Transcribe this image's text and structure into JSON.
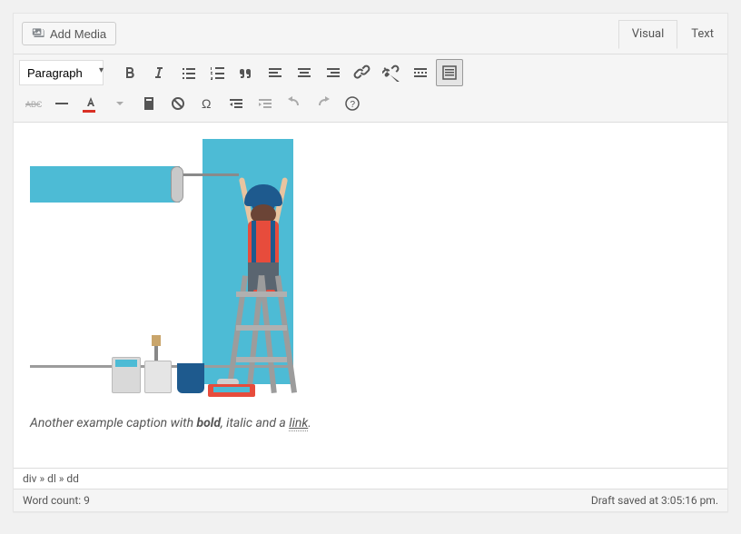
{
  "top": {
    "add_media": "Add Media",
    "tab_visual": "Visual",
    "tab_text": "Text"
  },
  "toolbar": {
    "format": "Paragraph"
  },
  "caption": {
    "t1": "Another example caption with ",
    "bold": "bold",
    "t2": ", italic and a ",
    "link": "link",
    "t3": "."
  },
  "path": "div » dl » dd",
  "status": {
    "wordcount": "Word count: 9",
    "saved": "Draft saved at 3:05:16 pm."
  }
}
